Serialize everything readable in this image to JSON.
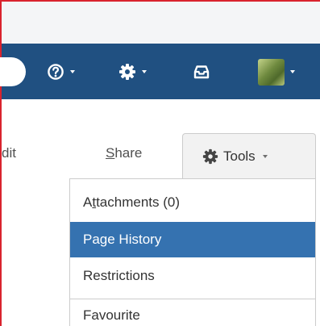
{
  "colors": {
    "header_bg": "#205081",
    "highlight_bg": "#3572b0",
    "frame_red": "#d9232e",
    "tools_button_bg": "#f2f2f2"
  },
  "header": {
    "items": [
      {
        "icon": "help-icon",
        "has_dropdown": true
      },
      {
        "icon": "gear-icon",
        "has_dropdown": true
      },
      {
        "icon": "inbox-icon",
        "has_dropdown": false
      },
      {
        "icon": "user-avatar",
        "has_dropdown": true
      }
    ]
  },
  "page_actions": {
    "edit_partial": "dit",
    "share_prefix": "",
    "share_underline": "S",
    "share_rest": "hare",
    "tools_label": "Tools"
  },
  "tools_menu": {
    "attachments": {
      "pre": "A",
      "ul": "t",
      "post": "tachments (0)"
    },
    "page_history": "Page History",
    "restrictions": "Restrictions",
    "favourite": "Favourite",
    "selected": "Page History"
  }
}
